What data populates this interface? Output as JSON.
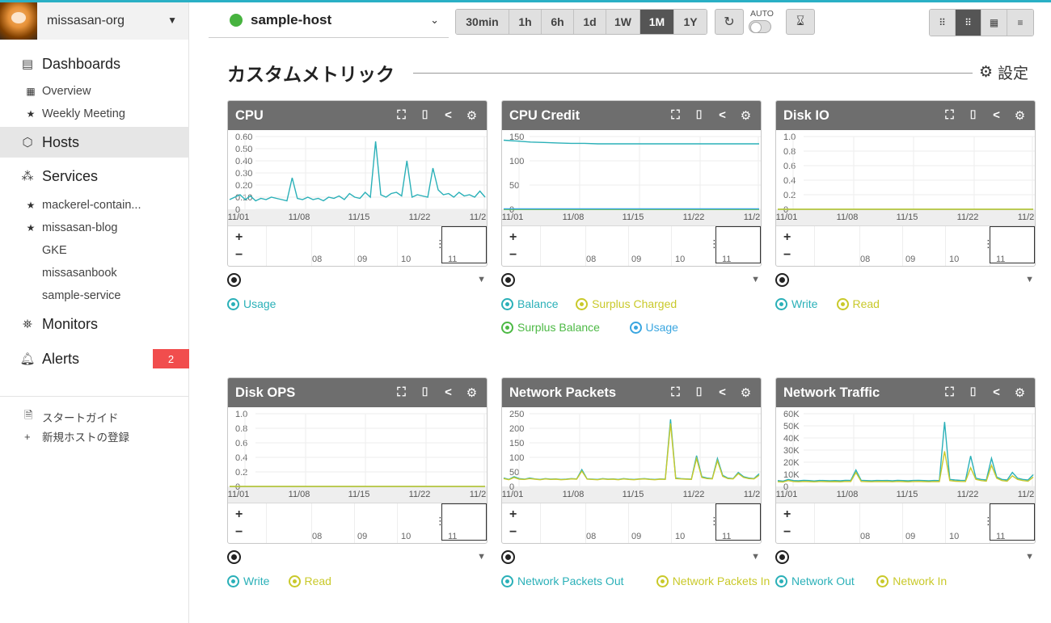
{
  "sidebar": {
    "org": "missasan-org",
    "dashboards": "Dashboards",
    "dash_items": [
      "Overview",
      "Weekly Meeting"
    ],
    "hosts": "Hosts",
    "services": "Services",
    "service_items": [
      "mackerel-contain...",
      "missasan-blog",
      "GKE",
      "missasanbook",
      "sample-service"
    ],
    "monitors": "Monitors",
    "alerts": "Alerts",
    "alerts_count": "2",
    "start_guide": "スタートガイド",
    "new_host": "新規ホストの登録"
  },
  "topbar": {
    "host": "sample-host",
    "ranges": [
      "30min",
      "1h",
      "6h",
      "1d",
      "1W",
      "1M",
      "1Y"
    ],
    "selected_range": "1M",
    "auto": "AUTO"
  },
  "page": {
    "title": "カスタムメトリック",
    "settings": "設定"
  },
  "colors": {
    "teal": "#2ab0b8",
    "yellow": "#c9c92a",
    "green": "#4cb944",
    "blue": "#3aa6e0",
    "header": "#6e6e6e",
    "alert": "#f14d4d"
  },
  "nav_ticks": [
    "08",
    "09",
    "10",
    "11"
  ],
  "graphs": [
    {
      "title": "CPU",
      "legend": [
        {
          "label": "Usage",
          "color": "#2ab0b8"
        }
      ],
      "chart_data": {
        "type": "line",
        "x_ticks": [
          "11/01",
          "11/08",
          "11/15",
          "11/22",
          "11/2"
        ],
        "y_ticks": [
          "0.60",
          "0.50",
          "0.40",
          "0.30",
          "0.20",
          "0.10",
          "0"
        ],
        "ylim": [
          0,
          0.6
        ],
        "series": [
          {
            "name": "Usage",
            "color": "#2ab0b8",
            "values": [
              0.08,
              0.1,
              0.12,
              0.08,
              0.11,
              0.07,
              0.09,
              0.08,
              0.1,
              0.09,
              0.08,
              0.07,
              0.26,
              0.09,
              0.08,
              0.1,
              0.08,
              0.09,
              0.07,
              0.1,
              0.09,
              0.11,
              0.08,
              0.13,
              0.1,
              0.09,
              0.14,
              0.1,
              0.56,
              0.12,
              0.1,
              0.13,
              0.14,
              0.11,
              0.4,
              0.1,
              0.12,
              0.11,
              0.1,
              0.34,
              0.16,
              0.12,
              0.13,
              0.1,
              0.14,
              0.11,
              0.12,
              0.1,
              0.15,
              0.1
            ]
          }
        ]
      }
    },
    {
      "title": "CPU Credit",
      "legend": [
        {
          "label": "Balance",
          "color": "#2ab0b8"
        },
        {
          "label": "Surplus Charged",
          "color": "#c9c92a"
        },
        {
          "label": "Surplus Balance",
          "color": "#4cb944"
        },
        {
          "label": "Usage",
          "color": "#3aa6e0"
        }
      ],
      "chart_data": {
        "type": "line",
        "x_ticks": [
          "11/01",
          "11/08",
          "11/15",
          "11/22",
          "11/2"
        ],
        "y_ticks": [
          "150",
          "100",
          "50",
          "0"
        ],
        "ylim": [
          0,
          160
        ],
        "series": [
          {
            "name": "Balance",
            "color": "#2ab0b8",
            "values": [
              152,
              150,
              148,
              147,
              146,
              145,
              145,
              144,
              144,
              144,
              144,
              144,
              144,
              144,
              144,
              144,
              144,
              144,
              144,
              144
            ]
          },
          {
            "name": "Surplus Charged",
            "color": "#c9c92a",
            "values": [
              0,
              0,
              0,
              0,
              0,
              0,
              0,
              0,
              0,
              0,
              0,
              0,
              0,
              0,
              0,
              0,
              0,
              0,
              0,
              0
            ]
          },
          {
            "name": "Surplus Balance",
            "color": "#4cb944",
            "values": [
              0,
              0,
              0,
              0,
              0,
              0,
              0,
              0,
              0,
              0,
              0,
              0,
              0,
              0,
              0,
              0,
              0,
              0,
              0,
              0
            ]
          },
          {
            "name": "Usage",
            "color": "#3aa6e0",
            "values": [
              1,
              1,
              1,
              1,
              1,
              1,
              1,
              1,
              1,
              1,
              1,
              1,
              1,
              1,
              1,
              1,
              1,
              1,
              1,
              1
            ]
          }
        ]
      }
    },
    {
      "title": "Disk IO",
      "legend": [
        {
          "label": "Write",
          "color": "#2ab0b8"
        },
        {
          "label": "Read",
          "color": "#c9c92a"
        }
      ],
      "chart_data": {
        "type": "line",
        "x_ticks": [
          "11/01",
          "11/08",
          "11/15",
          "11/22",
          "11/2"
        ],
        "y_ticks": [
          "1.0",
          "0.8",
          "0.6",
          "0.4",
          "0.2",
          "0"
        ],
        "ylim": [
          0,
          1
        ],
        "series": [
          {
            "name": "Write",
            "color": "#2ab0b8",
            "values": [
              0,
              0,
              0,
              0,
              0,
              0,
              0,
              0,
              0,
              0
            ]
          },
          {
            "name": "Read",
            "color": "#c9c92a",
            "values": [
              0,
              0,
              0,
              0,
              0,
              0,
              0,
              0,
              0,
              0
            ]
          }
        ]
      }
    },
    {
      "title": "Disk OPS",
      "legend": [
        {
          "label": "Write",
          "color": "#2ab0b8"
        },
        {
          "label": "Read",
          "color": "#c9c92a"
        }
      ],
      "chart_data": {
        "type": "line",
        "x_ticks": [
          "11/01",
          "11/08",
          "11/15",
          "11/22",
          "11/2"
        ],
        "y_ticks": [
          "1.0",
          "0.8",
          "0.6",
          "0.4",
          "0.2",
          "0"
        ],
        "ylim": [
          0,
          1
        ],
        "series": [
          {
            "name": "Write",
            "color": "#2ab0b8",
            "values": [
              0,
              0,
              0,
              0,
              0,
              0,
              0,
              0,
              0,
              0
            ]
          },
          {
            "name": "Read",
            "color": "#c9c92a",
            "values": [
              0,
              0,
              0,
              0,
              0,
              0,
              0,
              0,
              0,
              0
            ]
          }
        ]
      }
    },
    {
      "title": "Network Packets",
      "legend": [
        {
          "label": "Network Packets Out",
          "color": "#2ab0b8"
        },
        {
          "label": "Network Packets In",
          "color": "#c9c92a"
        }
      ],
      "chart_data": {
        "type": "line",
        "x_ticks": [
          "11/01",
          "11/08",
          "11/15",
          "11/22",
          "11/2"
        ],
        "y_ticks": [
          "250",
          "200",
          "150",
          "100",
          "50",
          "0"
        ],
        "ylim": [
          0,
          260
        ],
        "series": [
          {
            "name": "Network Packets Out",
            "color": "#2ab0b8",
            "values": [
              30,
              25,
              35,
              28,
              26,
              30,
              27,
              25,
              28,
              26,
              27,
              25,
              26,
              28,
              27,
              60,
              27,
              26,
              25,
              28,
              26,
              27,
              25,
              28,
              26,
              25,
              27,
              28,
              26,
              25,
              27,
              26,
              240,
              30,
              28,
              27,
              26,
              110,
              35,
              30,
              28,
              100,
              40,
              30,
              28,
              50,
              35,
              30,
              28,
              45
            ]
          },
          {
            "name": "Network Packets In",
            "color": "#c9c92a",
            "values": [
              28,
              24,
              32,
              26,
              25,
              28,
              26,
              24,
              27,
              25,
              26,
              24,
              25,
              27,
              26,
              55,
              26,
              25,
              24,
              27,
              25,
              26,
              24,
              27,
              25,
              24,
              26,
              27,
              25,
              24,
              26,
              25,
              225,
              28,
              27,
              26,
              25,
              100,
              32,
              28,
              27,
              92,
              36,
              28,
              27,
              46,
              32,
              28,
              27,
              40
            ]
          }
        ]
      }
    },
    {
      "title": "Network Traffic",
      "legend": [
        {
          "label": "Network Out",
          "color": "#2ab0b8"
        },
        {
          "label": "Network In",
          "color": "#c9c92a"
        }
      ],
      "chart_data": {
        "type": "line",
        "x_ticks": [
          "11/01",
          "11/08",
          "11/15",
          "11/22",
          "11/2"
        ],
        "y_ticks": [
          "60K",
          "50K",
          "40K",
          "30K",
          "20K",
          "10K",
          "0"
        ],
        "ylim": [
          0,
          62000
        ],
        "series": [
          {
            "name": "Network Out",
            "color": "#2ab0b8",
            "values": [
              5000,
              4500,
              6000,
              5000,
              4800,
              5200,
              5000,
              4700,
              5100,
              5000,
              4900,
              5000,
              4800,
              5200,
              5100,
              14000,
              5200,
              5000,
              4900,
              5100,
              5000,
              5100,
              4900,
              5200,
              5000,
              4800,
              5100,
              5200,
              5000,
              4900,
              5100,
              5000,
              55000,
              6000,
              5500,
              5200,
              5100,
              26000,
              7000,
              6000,
              5500,
              24000,
              8000,
              6000,
              5500,
              12000,
              7000,
              6000,
              5500,
              10000
            ]
          },
          {
            "name": "Network In",
            "color": "#c9c92a",
            "values": [
              4000,
              3800,
              5000,
              4200,
              4000,
              4300,
              4100,
              3900,
              4200,
              4100,
              4000,
              4100,
              3900,
              4300,
              4200,
              12000,
              4300,
              4100,
              4000,
              4200,
              4100,
              4200,
              4000,
              4300,
              4100,
              3900,
              4200,
              4300,
              4100,
              4000,
              4200,
              4100,
              30000,
              5000,
              4500,
              4300,
              4200,
              16000,
              6000,
              5000,
              4500,
              18000,
              7000,
              5000,
              4500,
              9000,
              6000,
              5000,
              4500,
              8000
            ]
          }
        ]
      }
    }
  ]
}
